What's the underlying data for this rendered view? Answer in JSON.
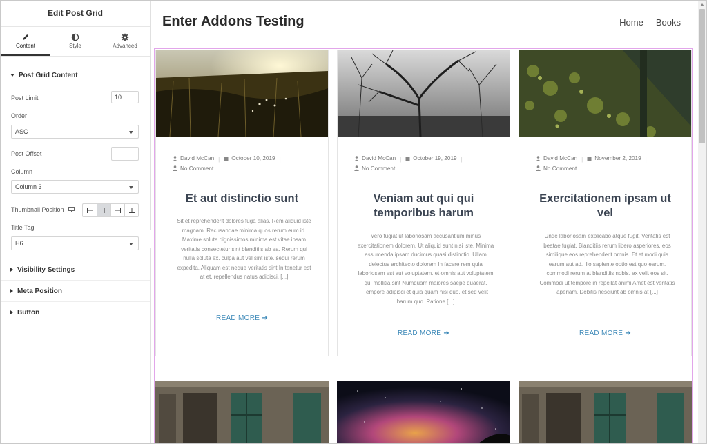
{
  "panel": {
    "title": "Edit Post Grid",
    "tabs": [
      {
        "label": "Content",
        "icon": "pencil-icon",
        "active": true
      },
      {
        "label": "Style",
        "icon": "half-circle-icon",
        "active": false
      },
      {
        "label": "Advanced",
        "icon": "gear-icon",
        "active": false
      }
    ],
    "content_section": "Post Grid Content",
    "post_limit_label": "Post Limit",
    "post_limit_value": "10",
    "order_label": "Order",
    "order_value": "ASC",
    "post_offset_label": "Post Offset",
    "post_offset_value": "",
    "column_label": "Column",
    "column_value": "Column 3",
    "thumb_pos_label": "Thumbnail Position",
    "thumb_pos_options": [
      "left",
      "top",
      "right",
      "bottom"
    ],
    "thumb_pos_selected": "top",
    "title_tag_label": "Title Tag",
    "title_tag_value": "H6",
    "sections": [
      "Visibility Settings",
      "Meta Position",
      "Button"
    ]
  },
  "site": {
    "title": "Enter Addons Testing",
    "nav": [
      "Home",
      "Books"
    ]
  },
  "posts": [
    {
      "author": "David McCan",
      "date": "October 10, 2019",
      "comments": "No Comment",
      "title": "Et aut distinctio sunt",
      "excerpt": "Sit et reprehenderit dolores fuga alias. Rem aliquid iste magnam. Recusandae minima quos rerum eum id. Maxime soluta dignissimos minima est vitae ipsam veritatis consectetur sint blanditiis ab ea. Rerum qui nulla soluta ex. culpa aut vel sint iste. sequi rerum expedita. Aliquam est neque veritatis sint In tenetur est at et. repellendus natus adipisci. [...]",
      "read_more": "READ MORE"
    },
    {
      "author": "David McCan",
      "date": "October 19, 2019",
      "comments": "No Comment",
      "title": "Veniam aut qui qui temporibus harum",
      "excerpt": "Vero fugiat ut laboriosam accusantium minus exercitationem dolorem. Ut aliquid sunt nisi iste. Minima assumenda ipsam ducimus quasi distinctio. Ullam delectus architecto dolorem In facere rem quia laboriosam est aut voluptatem. et omnis aut voluptatem qui mollitia sint Numquam maiores saepe quaerat. Tempore adipisci et quia quam nisi quo. et sed velit harum quo. Ratione [...]",
      "read_more": "READ MORE"
    },
    {
      "author": "David McCan",
      "date": "November 2, 2019",
      "comments": "No Comment",
      "title": "Exercitationem ipsam ut vel",
      "excerpt": "Unde laboriosam explicabo atque fugit. Veritatis est beatae fugiat. Blanditiis rerum libero asperiores. eos similique eos reprehenderit omnis. Et et modi quia earum aut ad. Illo sapiente optio est quo earum. commodi rerum at blanditiis nobis. ex velit eos sit. Commodi ut tempore in repellat animi Amet est veritatis aperiam. Debitis nesciunt ab omnis at [...]",
      "read_more": "READ MORE"
    }
  ],
  "colors": {
    "accent_link": "#3d89b8",
    "grid_outline": "#e2a6ea",
    "title_text": "#3b4452"
  }
}
